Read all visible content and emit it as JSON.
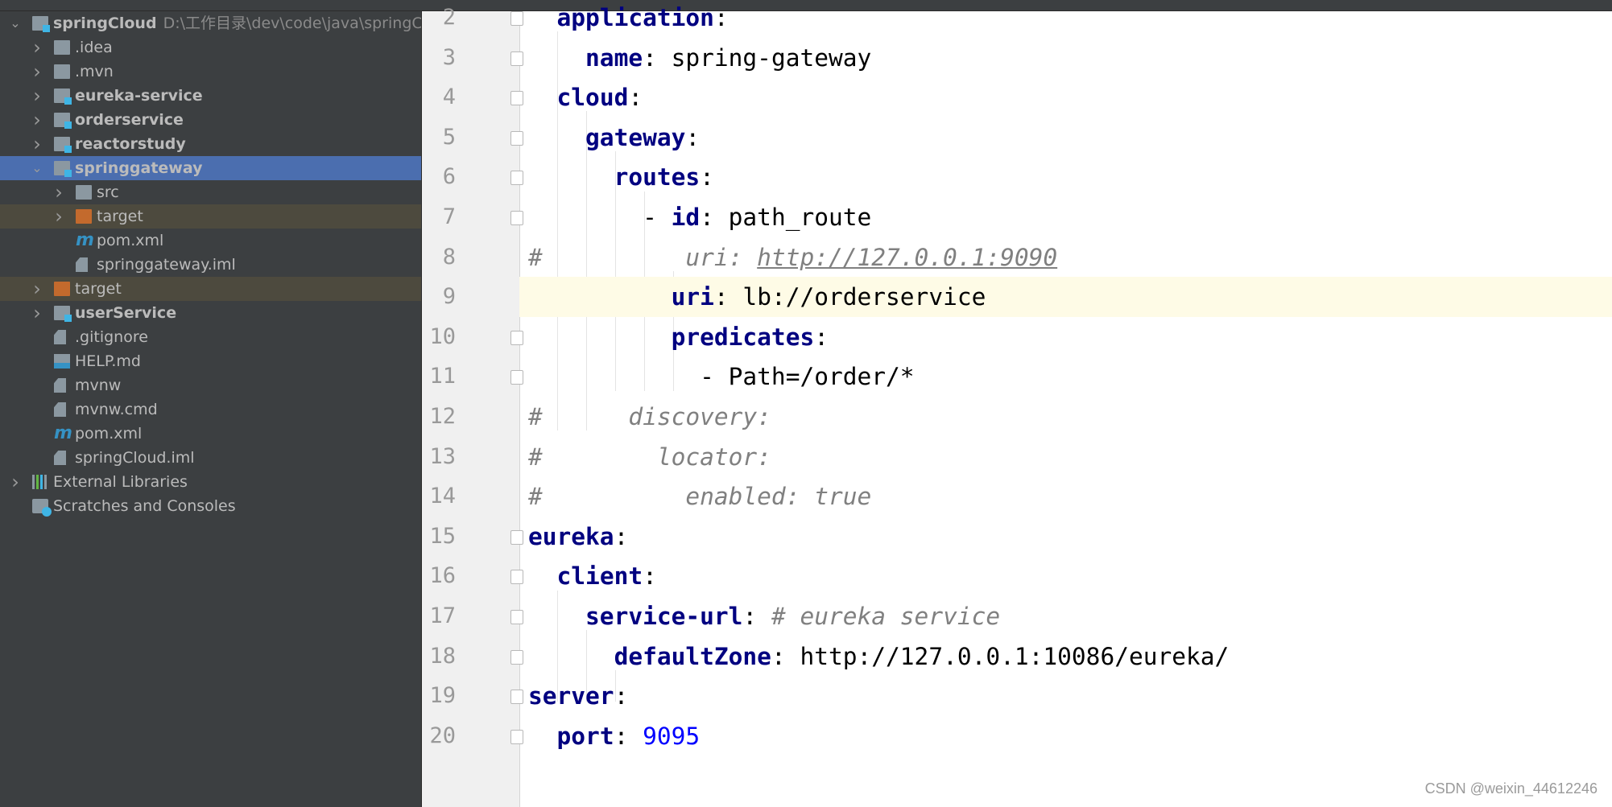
{
  "colors": {
    "sidebar_bg": "#3c3f41",
    "selected": "#4b6eaf",
    "excluded": "#4d4a3e",
    "key": "#000080",
    "number": "#0000ff",
    "comment": "#808080",
    "current_line": "#fefbe6"
  },
  "project_tree": [
    {
      "label": "springCloud",
      "path": "D:\\工作目录\\dev\\code\\java\\springCloud",
      "level": 0,
      "chevron": "down",
      "icon": "module-folder",
      "bold": true
    },
    {
      "label": ".idea",
      "level": 1,
      "chevron": "right",
      "icon": "folder"
    },
    {
      "label": ".mvn",
      "level": 1,
      "chevron": "right",
      "icon": "folder"
    },
    {
      "label": "eureka-service",
      "level": 1,
      "chevron": "right",
      "icon": "module-folder",
      "bold": true
    },
    {
      "label": "orderservice",
      "level": 1,
      "chevron": "right",
      "icon": "module-folder",
      "bold": true
    },
    {
      "label": "reactorstudy",
      "level": 1,
      "chevron": "right",
      "icon": "module-folder",
      "bold": true
    },
    {
      "label": "springgateway",
      "level": 1,
      "chevron": "down",
      "icon": "module-folder",
      "bold": true,
      "state": "sel"
    },
    {
      "label": "src",
      "level": 2,
      "chevron": "right",
      "icon": "folder"
    },
    {
      "label": "target",
      "level": 2,
      "chevron": "right",
      "icon": "folder-orange",
      "state": "excl"
    },
    {
      "label": "pom.xml",
      "level": 2,
      "icon": "maven"
    },
    {
      "label": "springgateway.iml",
      "level": 2,
      "icon": "iml-file"
    },
    {
      "label": "target",
      "level": 1,
      "chevron": "right",
      "icon": "folder-orange",
      "state": "excl"
    },
    {
      "label": "userService",
      "level": 1,
      "chevron": "right",
      "icon": "module-folder",
      "bold": true
    },
    {
      "label": ".gitignore",
      "level": 1,
      "icon": "gitignore-file"
    },
    {
      "label": "HELP.md",
      "level": 1,
      "icon": "markdown-file"
    },
    {
      "label": "mvnw",
      "level": 1,
      "icon": "shell-file"
    },
    {
      "label": "mvnw.cmd",
      "level": 1,
      "icon": "text-file"
    },
    {
      "label": "pom.xml",
      "level": 1,
      "icon": "maven"
    },
    {
      "label": "springCloud.iml",
      "level": 1,
      "icon": "iml-file"
    },
    {
      "label": "External Libraries",
      "level": 0,
      "chevron": "right",
      "icon": "libraries"
    },
    {
      "label": "Scratches and Consoles",
      "level": 0,
      "icon": "scratches"
    }
  ],
  "editor": {
    "current_line": 9,
    "lines": [
      {
        "n": "2",
        "fold": true,
        "t": [
          [
            "",
            "  "
          ],
          [
            "key",
            "application"
          ],
          [
            "",
            ":"
          ]
        ]
      },
      {
        "n": "3",
        "fold": true,
        "t": [
          [
            "",
            "    "
          ],
          [
            "key",
            "name"
          ],
          [
            "",
            ": spring-gateway"
          ]
        ]
      },
      {
        "n": "4",
        "fold": true,
        "t": [
          [
            "",
            "  "
          ],
          [
            "key",
            "cloud"
          ],
          [
            "",
            ":"
          ]
        ]
      },
      {
        "n": "5",
        "fold": true,
        "t": [
          [
            "",
            "    "
          ],
          [
            "key",
            "gateway"
          ],
          [
            "",
            ":"
          ]
        ]
      },
      {
        "n": "6",
        "fold": true,
        "t": [
          [
            "",
            "      "
          ],
          [
            "key",
            "routes"
          ],
          [
            "",
            ":"
          ]
        ]
      },
      {
        "n": "7",
        "fold": true,
        "t": [
          [
            "",
            "        - "
          ],
          [
            "key",
            "id"
          ],
          [
            "",
            ": path_route"
          ]
        ]
      },
      {
        "n": "8",
        "fold": false,
        "t": [
          [
            "cmt",
            "#          uri: "
          ],
          [
            "cmt url",
            "http://127.0.0.1:9090"
          ]
        ]
      },
      {
        "n": "9",
        "fold": false,
        "t": [
          [
            "",
            "          "
          ],
          [
            "key",
            "uri"
          ],
          [
            "",
            ": lb://orderservice"
          ]
        ]
      },
      {
        "n": "10",
        "fold": true,
        "t": [
          [
            "",
            "          "
          ],
          [
            "key",
            "predicates"
          ],
          [
            "",
            ":"
          ]
        ]
      },
      {
        "n": "11",
        "fold": true,
        "t": [
          [
            "",
            "            - Path=/order/*"
          ]
        ]
      },
      {
        "n": "12",
        "fold": false,
        "t": [
          [
            "cmt",
            "#      discovery:"
          ]
        ]
      },
      {
        "n": "13",
        "fold": false,
        "t": [
          [
            "cmt",
            "#        locator:"
          ]
        ]
      },
      {
        "n": "14",
        "fold": false,
        "t": [
          [
            "cmt",
            "#          enabled: true"
          ]
        ]
      },
      {
        "n": "15",
        "fold": true,
        "t": [
          [
            "key",
            "eureka"
          ],
          [
            "",
            ":"
          ]
        ]
      },
      {
        "n": "16",
        "fold": true,
        "t": [
          [
            "",
            "  "
          ],
          [
            "key",
            "client"
          ],
          [
            "",
            ":"
          ]
        ]
      },
      {
        "n": "17",
        "fold": true,
        "t": [
          [
            "",
            "    "
          ],
          [
            "key",
            "service-url"
          ],
          [
            "",
            ": "
          ],
          [
            "cmt",
            "# eureka service"
          ]
        ]
      },
      {
        "n": "18",
        "fold": true,
        "t": [
          [
            "",
            "      "
          ],
          [
            "key",
            "defaultZone"
          ],
          [
            "",
            ": http://127.0.0.1:10086/eureka/"
          ]
        ]
      },
      {
        "n": "19",
        "fold": true,
        "t": [
          [
            "key",
            "server"
          ],
          [
            "",
            ":"
          ]
        ]
      },
      {
        "n": "20",
        "fold": true,
        "t": [
          [
            "",
            "  "
          ],
          [
            "key",
            "port"
          ],
          [
            "",
            ": "
          ],
          [
            "num",
            "9095"
          ]
        ]
      }
    ]
  },
  "watermark": "CSDN @weixin_44612246"
}
